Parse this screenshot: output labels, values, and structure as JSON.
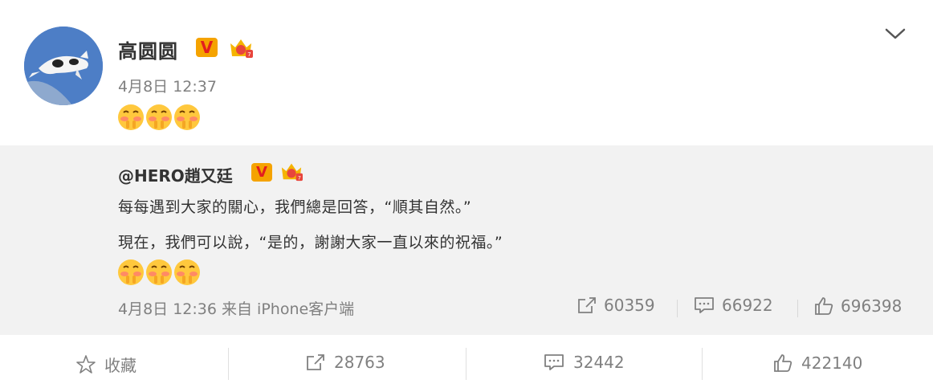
{
  "post": {
    "author": "高圆圆",
    "time": "4月8日 12:37",
    "emojis": [
      "shy-emoji",
      "shy-emoji",
      "shy-emoji"
    ],
    "verified_badge": "V"
  },
  "repost": {
    "author": "@HERO趙又廷",
    "verified_badge": "V",
    "line1": "每每遇到大家的關心，我們總是回答，“順其自然。”",
    "line2": "現在，我們可以說，“是的，謝謝大家一直以來的祝福。”",
    "emojis": [
      "shy-emoji",
      "shy-emoji",
      "shy-emoji"
    ],
    "meta": "4月8日 12:36 来自 iPhone客户端",
    "stats": {
      "reposts": "60359",
      "comments": "66922",
      "likes": "696398"
    }
  },
  "actions": {
    "favorite_label": "收藏",
    "reposts": "28763",
    "comments": "32442",
    "likes": "422140"
  },
  "colors": {
    "accent_gold": "#f5a300",
    "badge_red": "#e31e1e",
    "muted_text": "#808080",
    "repost_bg": "#f2f2f2"
  }
}
